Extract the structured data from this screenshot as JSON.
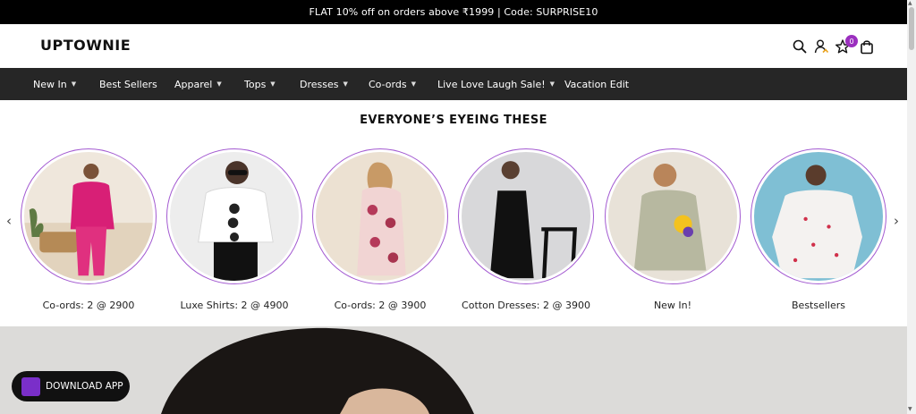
{
  "announcement": "FLAT 10% off on orders above ₹1999 | Code: SURPRISE10",
  "brand": "UPTOWNIE",
  "header_icons": [
    "search-icon",
    "account-icon",
    "wishlist-star-icon",
    "cart-bag-icon"
  ],
  "wishlist_count": "0",
  "nav": [
    {
      "label": "New In",
      "has_dropdown": true
    },
    {
      "label": "Best Sellers",
      "has_dropdown": false
    },
    {
      "label": "Apparel",
      "has_dropdown": true
    },
    {
      "label": "Tops",
      "has_dropdown": true
    },
    {
      "label": "Dresses",
      "has_dropdown": true
    },
    {
      "label": "Co-ords",
      "has_dropdown": true
    },
    {
      "label": "Live Love Laugh Sale!",
      "has_dropdown": true
    },
    {
      "label": "Vacation Edit",
      "has_dropdown": false
    }
  ],
  "section_title": "EVERYONE’S EYEING THESE",
  "collections": [
    {
      "caption": "Co-ords: 2 @ 2900"
    },
    {
      "caption": "Luxe Shirts: 2 @ 4900"
    },
    {
      "caption": "Co-ords: 2 @ 3900"
    },
    {
      "caption": "Cotton Dresses: 2 @ 3900"
    },
    {
      "caption": "New In!"
    },
    {
      "caption": "Bestsellers"
    }
  ],
  "download_app_label": "DOWNLOAD APP",
  "colors": {
    "accent": "#9b2fbf",
    "nav_bg": "#262626",
    "announcement_bg": "#000000"
  }
}
